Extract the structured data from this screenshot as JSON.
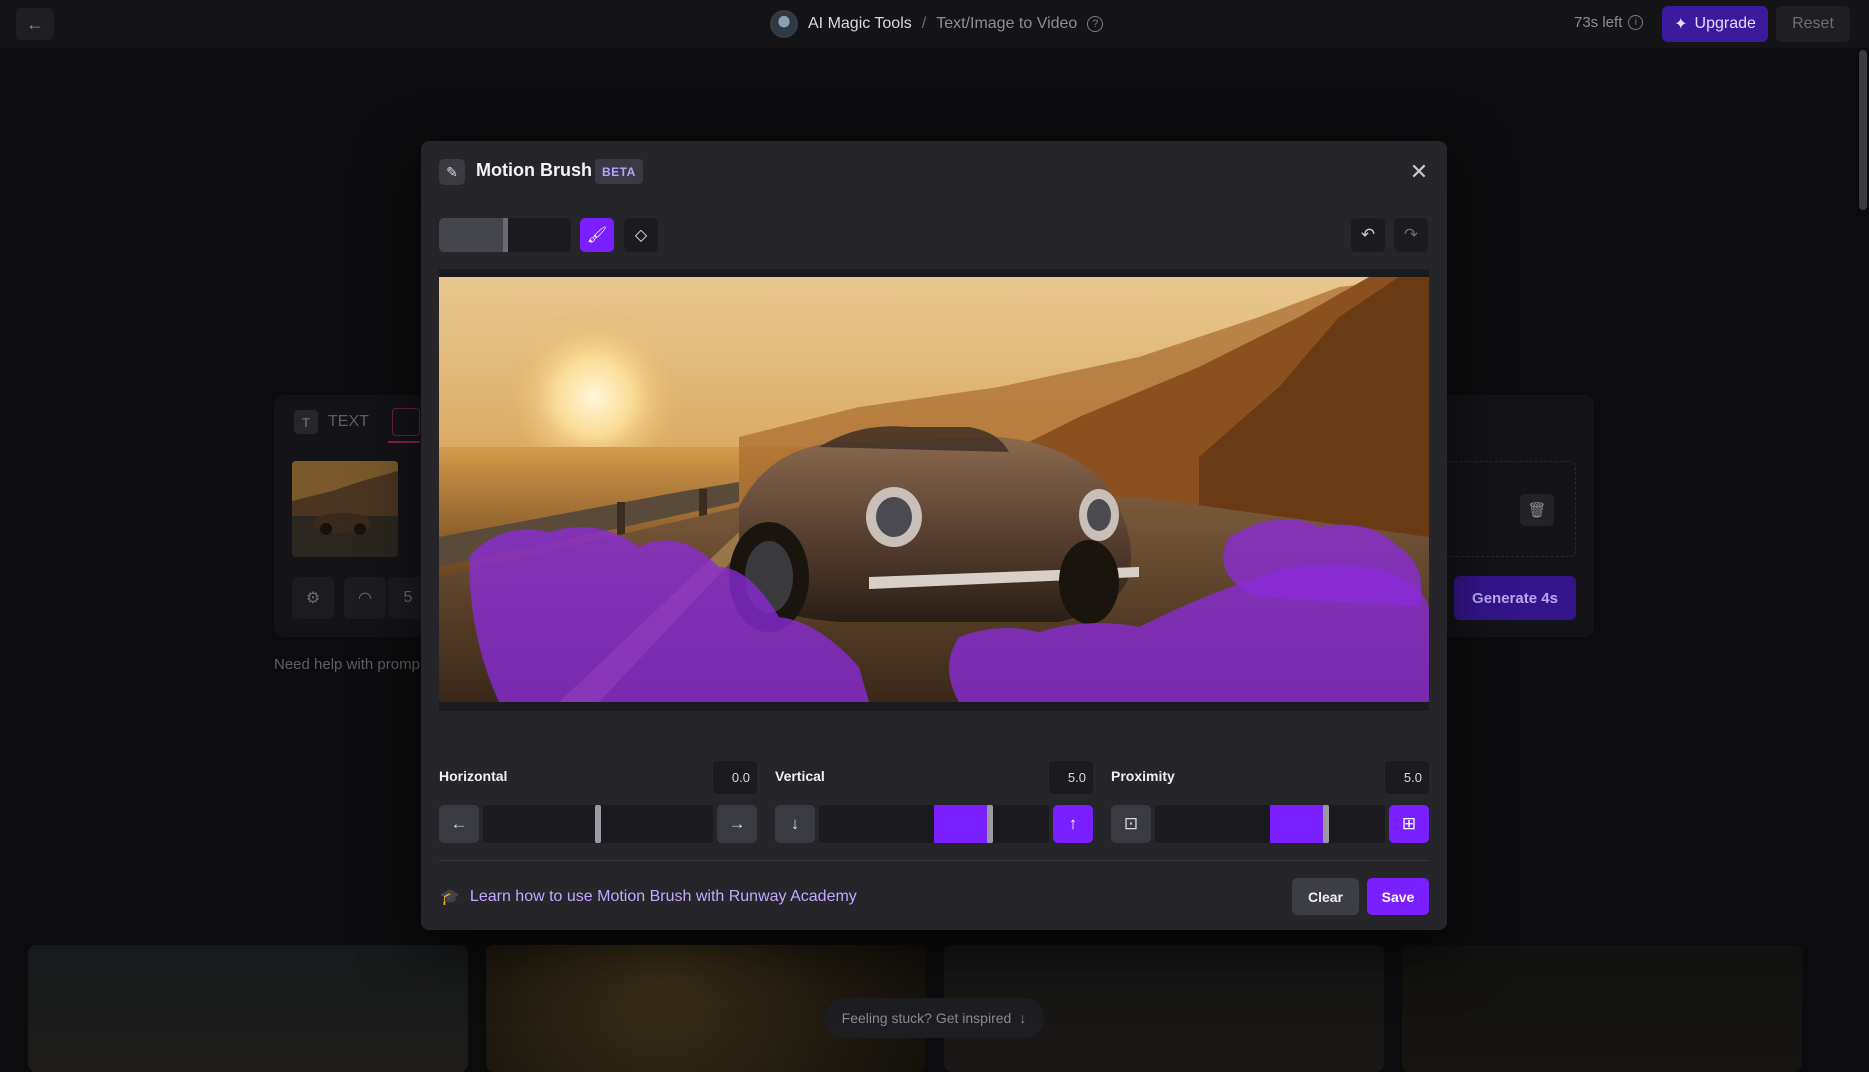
{
  "topbar": {
    "breadcrumb": [
      "AI Magic Tools",
      "/",
      "Text/Image to Video"
    ],
    "credits": "73s left",
    "upgrade_label": "Upgrade",
    "reset_label": "Reset"
  },
  "background": {
    "tab_text": "TEXT",
    "duration": "5",
    "generate_label": "Generate 4s",
    "help_text": "Need help with promp",
    "inspire": "Feeling stuck? Get inspired"
  },
  "modal": {
    "title": "Motion Brush",
    "badge": "BETA",
    "sliders": {
      "horizontal": {
        "label": "Horizontal",
        "value": "0.0"
      },
      "vertical": {
        "label": "Vertical",
        "value": "5.0"
      },
      "proximity": {
        "label": "Proximity",
        "value": "5.0"
      }
    },
    "learn_link": "Learn how to use Motion Brush with Runway Academy",
    "clear_label": "Clear",
    "save_label": "Save"
  },
  "colors": {
    "accent": "#7a1fff",
    "modal_bg": "#25252a",
    "page_bg": "#0c0c0e"
  }
}
